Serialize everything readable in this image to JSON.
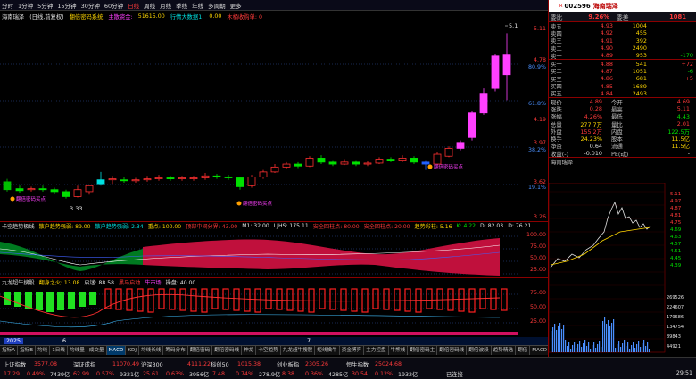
{
  "toolbar": {
    "items": [
      "分时",
      "1分钟",
      "5分钟",
      "15分钟",
      "30分钟",
      "60分钟",
      "日线",
      "周线",
      "月线",
      "季线",
      "年线",
      "多周期",
      "更多"
    ],
    "active_index": 6,
    "buttons": [
      "统计",
      "画线",
      "F10",
      "标记",
      "+自选",
      "返回"
    ]
  },
  "chart_header": {
    "name": "海南瑞泽",
    "period": "(日线,前复权)",
    "indicator": "翻倍密码系统",
    "volume_label": "主散资金:",
    "volume_value": "51615.00",
    "right_label": "行情大数据1:",
    "right_value": "0.00",
    "extra": "木桶收购单: 0"
  },
  "price_axis": [
    "5.11",
    "4.78",
    "80.9%",
    "61.8%",
    "4.19",
    "3.97",
    "38.2%",
    "3.62",
    "19.1%",
    "3.26"
  ],
  "chart_annotations": {
    "high": "5.11",
    "low": "3.33",
    "buy1": "翻倍密码买点",
    "buy2": "翻倍密码买点",
    "buy3": "翻倍密码买点"
  },
  "ind1_header": {
    "name": "卡空趋势极线",
    "a": "散户趋势强弱: 89.00",
    "b": "散户趋势强弱: 2.34",
    "c": "重点: 100.00",
    "d": "顶部中间分界: 43.00",
    "e": "M1: 32.00",
    "f": "LJHS: 175.11",
    "g": "安全回柱点: 80.00",
    "h": "安全回柱点: 20.00",
    "i": "趋势彩柱: 5.16",
    "j": "K: 4.22",
    "k": "D: 82.03",
    "l": "D: 76.21"
  },
  "ind1_axis": [
    "100.00",
    "75.00",
    "50.00",
    "25.00"
  ],
  "ind2_header": {
    "name": "九龙超牛搜股",
    "a": "翻身之火: 13.08",
    "b": "启迷: 88.58",
    "c": "黑马启动",
    "d": "牛市场",
    "e": "操盘: 40.00"
  },
  "ind2_axis": [
    "75.00",
    "50.00",
    "25.00"
  ],
  "date_bar": {
    "year": "2025",
    "mark1": "6",
    "mark2": "7"
  },
  "tabs": [
    "指标A",
    "指标B",
    "均线",
    "1日线",
    "均线量",
    "成交量",
    "MACD",
    "KDJ",
    "均线长线",
    "筹码分布",
    "翻倍密码",
    "翻倍密码线",
    "神龙",
    "卡空趋势",
    "九龙超牛搜股",
    "短线擒牛",
    "资金博弈",
    "主力控盘",
    "牛熊线",
    "翻倍密码主",
    "翻倍密码线",
    "翻倍波段",
    "趋势精选",
    "翻倍",
    "MACD"
  ],
  "active_tab_index": 6,
  "orderbook": {
    "webi_label": "委比",
    "webi_value": "9.26%",
    "weicha_label": "委差",
    "weicha_value": "1081",
    "asks": [
      {
        "lbl": "卖五",
        "p": "4.93",
        "v": "1004",
        "c": ""
      },
      {
        "lbl": "卖四",
        "p": "4.92",
        "v": "455",
        "c": ""
      },
      {
        "lbl": "卖三",
        "p": "4.91",
        "v": "392",
        "c": ""
      },
      {
        "lbl": "卖二",
        "p": "4.90",
        "v": "2490",
        "c": ""
      },
      {
        "lbl": "卖一",
        "p": "4.89",
        "v": "953",
        "c": "-170"
      }
    ],
    "bids": [
      {
        "lbl": "买一",
        "p": "4.88",
        "v": "541",
        "c": "+72"
      },
      {
        "lbl": "买二",
        "p": "4.87",
        "v": "1051",
        "c": "-6"
      },
      {
        "lbl": "买三",
        "p": "4.86",
        "v": "681",
        "c": "+5"
      },
      {
        "lbl": "买四",
        "p": "4.85",
        "v": "1689",
        "c": ""
      },
      {
        "lbl": "买五",
        "p": "4.84",
        "v": "2493",
        "c": ""
      }
    ]
  },
  "quote": [
    {
      "l1": "现价",
      "v1": "4.89",
      "l2": "今开",
      "v2": "4.69",
      "v1c": "red",
      "v2c": "red"
    },
    {
      "l1": "涨跌",
      "v1": "0.28",
      "l2": "最高",
      "v2": "5.11",
      "v1c": "red",
      "v2c": "red"
    },
    {
      "l1": "涨幅",
      "v1": "4.26%",
      "l2": "最低",
      "v2": "4.43",
      "v1c": "red",
      "v2c": "green"
    },
    {
      "l1": "总量",
      "v1": "277.7万",
      "l2": "量比",
      "v2": "2.01",
      "v1c": "yellow",
      "v2c": "red"
    },
    {
      "l1": "外盘",
      "v1": "155.2万",
      "l2": "内盘",
      "v2": "122.5万",
      "v1c": "red",
      "v2c": "green"
    },
    {
      "l1": "换手",
      "v1": "24.23%",
      "l2": "股本",
      "v2": "11.5亿",
      "v1c": "yellow",
      "v2c": "yellow"
    },
    {
      "l1": "净资",
      "v1": "0.64",
      "l2": "流通",
      "v2": "11.5亿",
      "v1c": "white",
      "v2c": "yellow"
    },
    {
      "l1": "收益(-)",
      "v1": "-0.010",
      "l2": "PE(动)",
      "v2": "-",
      "v1c": "white",
      "v2c": "white"
    }
  ],
  "stock": {
    "code": "002596",
    "name": "海南瑞泽",
    "r": "R"
  },
  "mini_chart": {
    "title": "海南瑞泽",
    "right_axis": [
      "5.11",
      "4.97",
      "4.87",
      "4.81",
      "4.75",
      "4.69",
      "4.63",
      "4.57",
      "4.51",
      "4.45",
      "4.39"
    ],
    "vol_axis": [
      "269526",
      "224607",
      "179686",
      "134754",
      "89843",
      "44921"
    ]
  },
  "status_bar": {
    "names": [
      "上证指数",
      "3577.08",
      "深证成指",
      "11070.49",
      "沪深300",
      "4111.22",
      "科创50",
      "1015.38",
      "创业板指",
      "2305.26",
      "恒生指数",
      "25024.68"
    ],
    "values": [
      "17.29",
      "0.49%",
      "7439亿",
      "62.99",
      "0.57%",
      "9321亿",
      "25.61",
      "0.63%",
      "3956亿",
      "7.48",
      "0.74%",
      "278.9亿",
      "8.38",
      "0.36%",
      "4285亿",
      "30.54",
      "0.12%",
      "1932亿"
    ],
    "time": "29:51",
    "connected": "已连接"
  }
}
